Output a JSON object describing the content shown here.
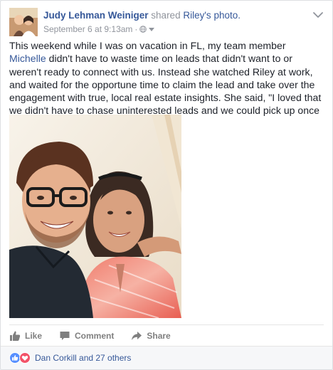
{
  "post": {
    "author": "Judy Lehman Weiniger",
    "action": "shared",
    "shared_owner": "Riley",
    "shared_suffix": "'s photo.",
    "timestamp": "September 6 at 9:13am",
    "separator": "·",
    "privacy_icon": "globe-icon",
    "menu_icon": "chevron-down-icon",
    "text_part1": "This weekend while I was on vacation in FL, my team member ",
    "mention": "Michelle",
    "text_part2": " didn't have to waste time on leads that didn't want to or weren't ready to connect with us. Instead she watched Riley at work, and waited for the opportune time to claim the lead and take over the engagement with true, local real estate insights. She said, \"I loved that we didn't have to chase uninterested leads and we could pick up once they had gotten engaged. Cool!!\""
  },
  "actions": {
    "like_label": "Like",
    "comment_label": "Comment",
    "share_label": "Share"
  },
  "reactions": {
    "icons": [
      "like-reaction-icon",
      "love-reaction-icon"
    ],
    "summary": "Dan Corkill and 27 others"
  },
  "colors": {
    "link": "#365899",
    "muted": "#90949c",
    "action_gray": "#7f7f7f",
    "like_blue": "#5890ff",
    "love_red": "#f25268"
  }
}
